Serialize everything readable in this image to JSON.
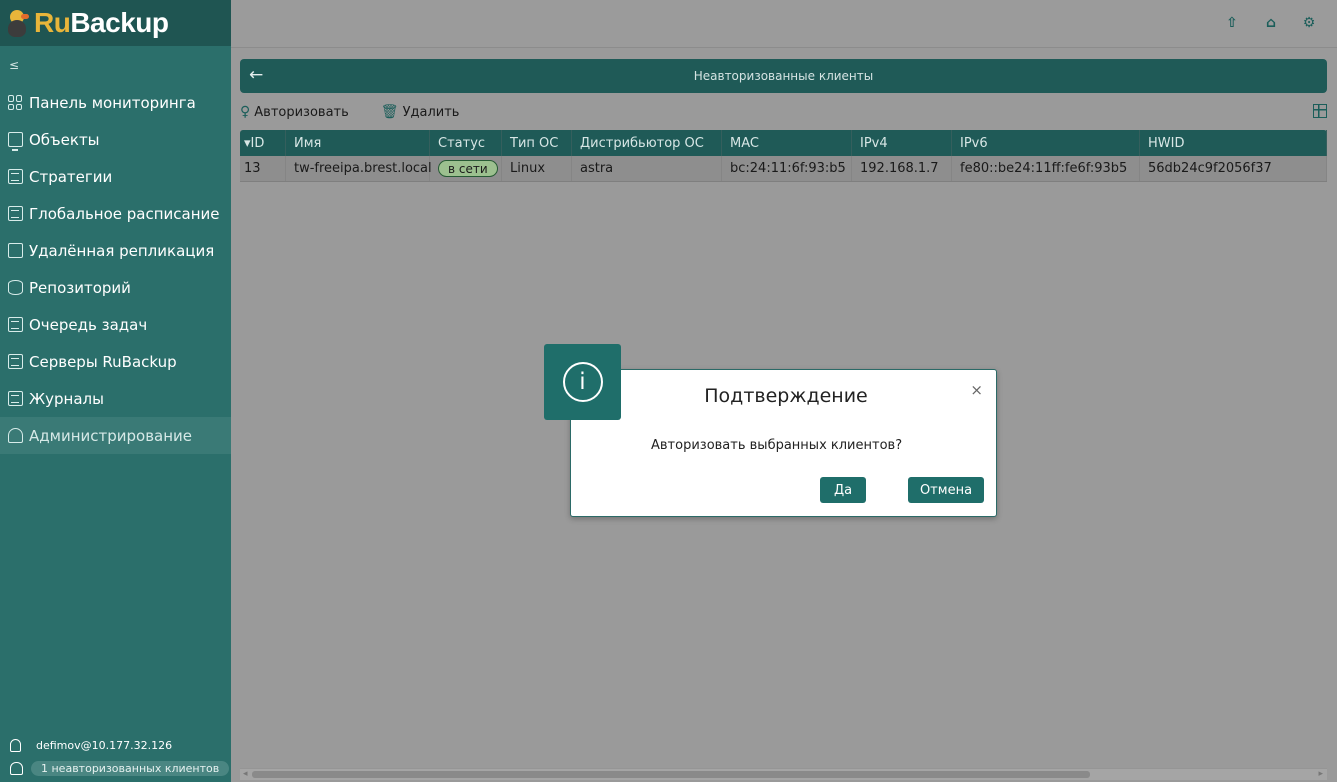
{
  "app": {
    "logo_ru": "Ru",
    "logo_backup": "Backup"
  },
  "sidebar": {
    "collapse_glyph": "≤",
    "items": [
      {
        "label": "Панель мониторинга",
        "icon": "dashboard-grid-icon"
      },
      {
        "label": "Объекты",
        "icon": "monitor-icon"
      },
      {
        "label": "Стратегии",
        "icon": "document-icon"
      },
      {
        "label": "Глобальное расписание",
        "icon": "schedule-icon"
      },
      {
        "label": "Удалённая репликация",
        "icon": "replication-icon"
      },
      {
        "label": "Репозиторий",
        "icon": "database-icon"
      },
      {
        "label": "Очередь задач",
        "icon": "task-queue-icon"
      },
      {
        "label": "Серверы RuBackup",
        "icon": "server-icon"
      },
      {
        "label": "Журналы",
        "icon": "log-icon"
      },
      {
        "label": "Администрирование",
        "icon": "admin-user-icon"
      }
    ],
    "active_index": 9,
    "user": "defimov@10.177.32.126",
    "unauthorized_clients": "1 неавторизованных клиентов"
  },
  "topbar": {
    "icons": [
      "upload-icon",
      "user-icon",
      "settings-icon"
    ]
  },
  "header": {
    "back_glyph": "←",
    "title": "Неавторизованные клиенты"
  },
  "toolbar": {
    "authorize": "Авторизовать",
    "delete": "Удалить"
  },
  "table": {
    "columns": [
      "ID",
      "Имя",
      "Статус",
      "Тип ОС",
      "Дистрибьютор ОС",
      "MAC",
      "IPv4",
      "IPv6",
      "HWID"
    ],
    "sort_glyph": "▾",
    "rows": [
      {
        "id": "13",
        "name": "tw-freeipa.brest.local",
        "status": "в сети",
        "os": "Linux",
        "distr": "astra",
        "mac": "bc:24:11:6f:93:b5",
        "ipv4": "192.168.1.7",
        "ipv6": "fe80::be24:11ff:fe6f:93b5",
        "hwid": "56db24c9f2056f37"
      }
    ]
  },
  "dialog": {
    "info_glyph": "i",
    "title": "Подтверждение",
    "close_glyph": "×",
    "message": "Авторизовать выбранных клиентов?",
    "yes": "Да",
    "cancel": "Отмена"
  },
  "colors": {
    "sidebar": "#2b6f6b",
    "accent": "#1f6e6a",
    "overlay": "#9b9b9b",
    "status_online": "#9cc08f"
  }
}
